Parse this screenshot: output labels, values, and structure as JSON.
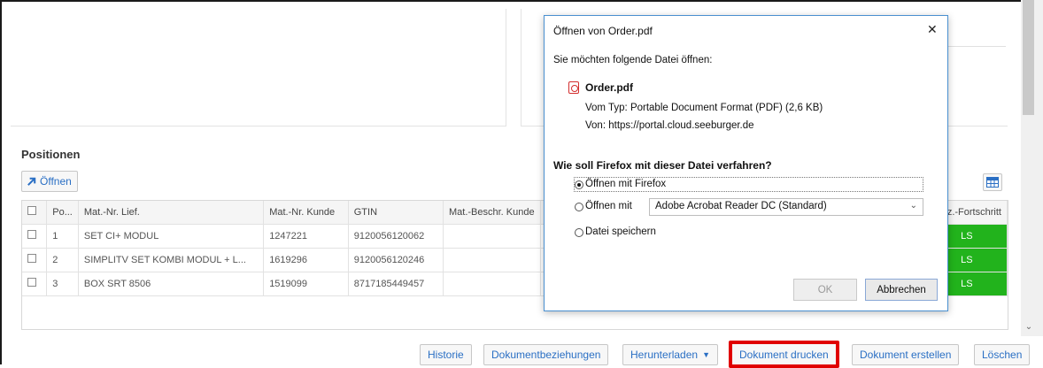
{
  "section": {
    "title": "Positionen",
    "open_button": "Öffnen"
  },
  "table": {
    "headers": [
      "Po...",
      "Mat.-Nr. Lief.",
      "Mat.-Nr. Kunde",
      "GTIN",
      "Mat.-Beschr. Kunde",
      "Proz.-Fortschritt"
    ],
    "rows": [
      {
        "pos": "1",
        "mat_lief": "SET CI+ MODUL",
        "mat_kunde": "1247221",
        "gtin": "9120056120062",
        "status": "LS"
      },
      {
        "pos": "2",
        "mat_lief": "SIMPLITV SET KOMBI MODUL + L...",
        "mat_kunde": "1619296",
        "gtin": "9120056120246",
        "status": "LS"
      },
      {
        "pos": "3",
        "mat_lief": "BOX SRT 8506",
        "mat_kunde": "1519099",
        "gtin": "8717185449457",
        "status": "LS"
      }
    ]
  },
  "bottom_buttons": {
    "historie": "Historie",
    "beziehungen": "Dokumentbeziehungen",
    "herunterladen": "Herunterladen",
    "drucken": "Dokument drucken",
    "erstellen": "Dokument erstellen",
    "loeschen": "Löschen"
  },
  "dialog": {
    "title": "Öffnen von Order.pdf",
    "close": "✕",
    "prompt": "Sie möchten folgende Datei öffnen:",
    "filename": "Order.pdf",
    "type_label": "Vom Typ:",
    "type_value": "Portable Document Format (PDF) (2,6 KB)",
    "from_label": "Von:",
    "from_value": "https://portal.cloud.seeburger.de",
    "question": "Wie soll Firefox mit dieser Datei verfahren?",
    "opt_firefox": "Öffnen mit Firefox",
    "opt_with": "Öffnen mit",
    "app_selected": "Adobe Acrobat Reader DC (Standard)",
    "opt_save": "Datei speichern",
    "ok": "OK",
    "cancel": "Abbrechen"
  },
  "colors": {
    "status_green": "#22b31c",
    "link_blue": "#2a6fc4",
    "highlight_red": "#e00000"
  }
}
